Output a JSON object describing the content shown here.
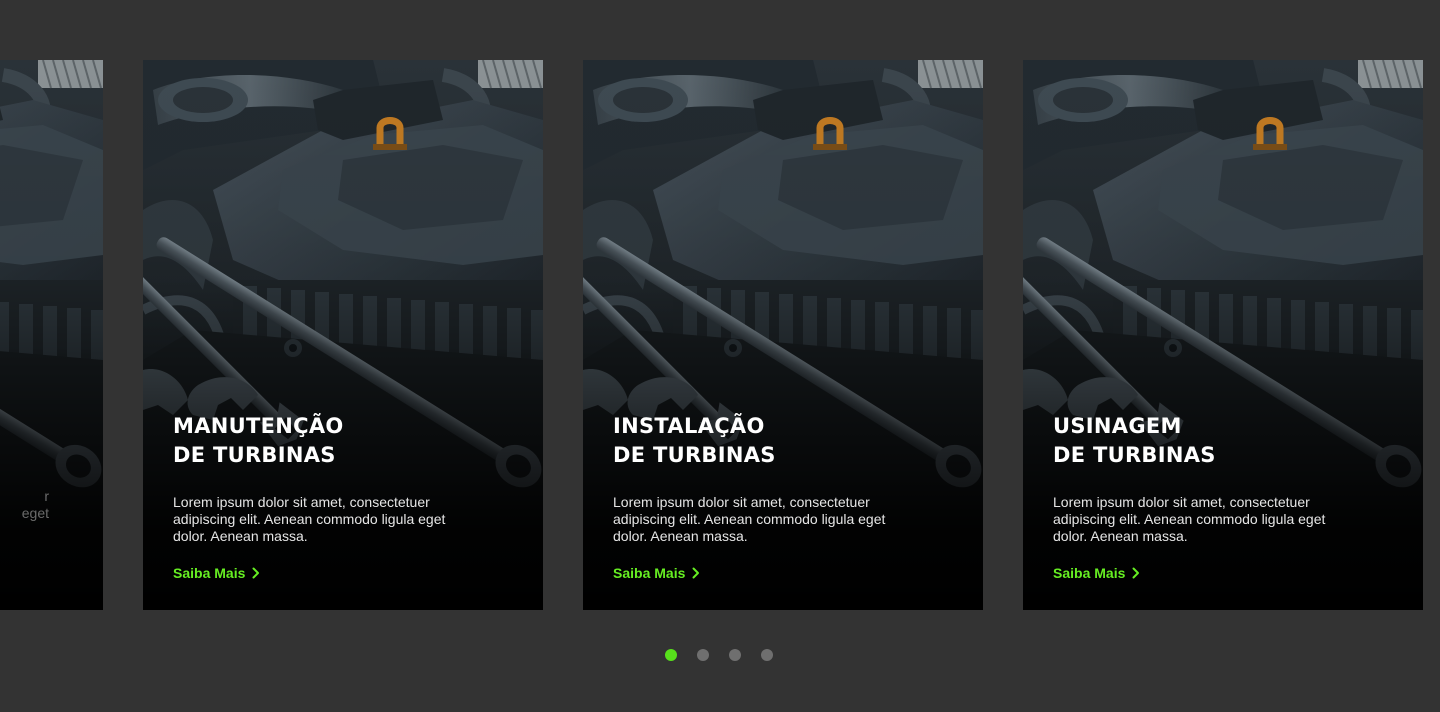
{
  "carousel": {
    "cards": [
      {
        "title_line1": "",
        "title_line2": "",
        "text_line1": "r",
        "text_line2": "eget",
        "text_line3": "",
        "link_label": ""
      },
      {
        "title_line1": "MANUTENÇÃO",
        "title_line2": "DE TURBINAS",
        "text_line1": "Lorem ipsum dolor sit amet, consectetuer",
        "text_line2": "adipiscing elit. Aenean commodo ligula eget",
        "text_line3": "dolor. Aenean massa.",
        "link_label": "Saiba Mais"
      },
      {
        "title_line1": "INSTALAÇÃO",
        "title_line2": "DE TURBINAS",
        "text_line1": "Lorem ipsum dolor sit amet, consectetuer",
        "text_line2": "adipiscing elit. Aenean commodo ligula eget",
        "text_line3": "dolor. Aenean massa.",
        "link_label": "Saiba Mais"
      },
      {
        "title_line1": "USINAGEM",
        "title_line2": "DE TURBINAS",
        "text_line1": "Lorem ipsum dolor sit amet, consectetuer",
        "text_line2": "adipiscing elit. Aenean commodo ligula eget",
        "text_line3": "dolor. Aenean massa.",
        "link_label": "Saiba Mais"
      }
    ],
    "image_icon": "engine-bay-wrench-photo",
    "link_icon": "chevron-right-icon",
    "pagination": {
      "count": 4,
      "active_index": 0
    }
  },
  "colors": {
    "background": "#333333",
    "accent": "#66ee22",
    "dot_active": "#57e01b",
    "dot_inactive": "#6f6f6f",
    "title": "#ffffff"
  }
}
